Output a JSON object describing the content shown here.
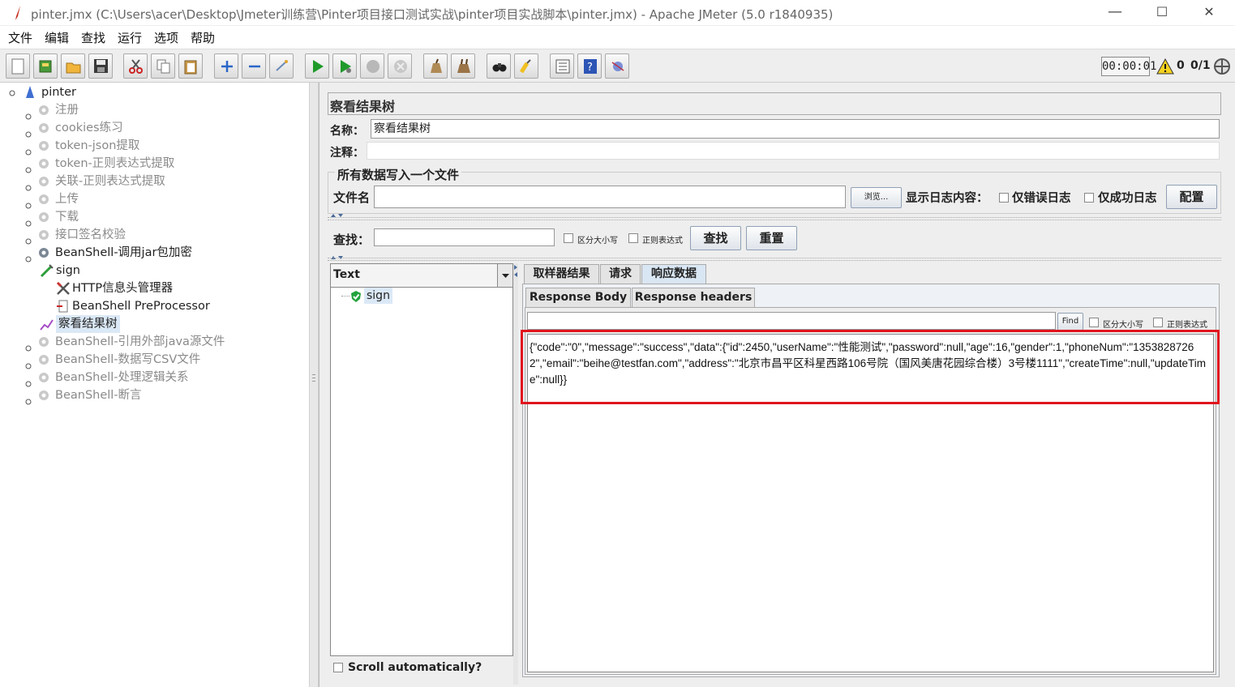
{
  "window": {
    "title": "pinter.jmx (C:\\Users\\acer\\Desktop\\Jmeter训练营\\Pinter项目接口测试实战\\pinter项目实战脚本\\pinter.jmx) - Apache JMeter (5.0 r1840935)",
    "minimize": "—",
    "maximize": "☐",
    "close": "✕"
  },
  "menu": [
    "文件",
    "编辑",
    "查找",
    "运行",
    "选项",
    "帮助"
  ],
  "toolbar": {
    "buttons": [
      "new-icon",
      "templates-icon",
      "open-icon",
      "save-icon",
      "cut-icon",
      "copy-icon",
      "paste-icon",
      "expand-icon",
      "collapse-icon",
      "toggle-icon",
      "start-icon",
      "start-no-pause-icon",
      "stop-icon",
      "shutdown-icon",
      "clear-icon",
      "clear-all-icon",
      "search-icon",
      "reset-search-icon",
      "function-helper-icon",
      "help-icon",
      "remote-icon"
    ],
    "timer": "00:00:01",
    "warnings": "0",
    "threads": "0/1"
  },
  "tree": {
    "root": "pinter",
    "items": [
      {
        "label": "注册",
        "enabled": false
      },
      {
        "label": "cookies练习",
        "enabled": false
      },
      {
        "label": "token-json提取",
        "enabled": false
      },
      {
        "label": "token-正则表达式提取",
        "enabled": false
      },
      {
        "label": "关联-正则表达式提取",
        "enabled": false
      },
      {
        "label": "上传",
        "enabled": false
      },
      {
        "label": "下载",
        "enabled": false
      },
      {
        "label": "接口签名校验",
        "enabled": false
      },
      {
        "label": "BeanShell-调用jar包加密",
        "enabled": true
      },
      {
        "label": "BeanShell-引用外部java源文件",
        "enabled": false
      },
      {
        "label": "BeanShell-数据写CSV文件",
        "enabled": false
      },
      {
        "label": "BeanShell-处理逻辑关系",
        "enabled": false
      },
      {
        "label": "BeanShell-断言",
        "enabled": false
      }
    ],
    "children": {
      "sampler": "sign",
      "header_manager": "HTTP信息头管理器",
      "preprocessor": "BeanShell PreProcessor",
      "listener": "察看结果树"
    }
  },
  "panel": {
    "title": "察看结果树",
    "name_label": "名称：",
    "name_value": "察看结果树",
    "comment_label": "注释：",
    "comment_value": "",
    "file_section": "所有数据写入一个文件",
    "filename_label": "文件名",
    "filename_value": "",
    "browse": "浏览...",
    "log_label": "显示日志内容：",
    "errors_only": "仅错误日志",
    "success_only": "仅成功日志",
    "configure": "配置",
    "search_label": "查找：",
    "search_value": "",
    "case_sensitive": "区分大小写",
    "regex": "正则表达式",
    "find_button": "查找",
    "reset_button": "重置",
    "renderer": "Text",
    "result_item": "sign",
    "tabs": [
      "取样器结果",
      "请求",
      "响应数据"
    ],
    "selected_tab": "响应数据",
    "subtabs": [
      "Response Body",
      "Response headers"
    ],
    "inner_find": "Find",
    "inner_case": "区分大小写",
    "inner_regex": "正则表达式",
    "response_text": "{\"code\":\"0\",\"message\":\"success\",\"data\":{\"id\":2450,\"userName\":\"性能测试\",\"password\":null,\"age\":16,\"gender\":1,\"phoneNum\":\"13538287262\",\"email\":\"beihe@testfan.com\",\"address\":\"北京市昌平区科星西路106号院（国风美唐花园综合楼）3号楼1111\",\"createTime\":null,\"updateTime\":null}}",
    "scroll_auto": "Scroll automatically?",
    "highlight_color": "#e0141e"
  }
}
